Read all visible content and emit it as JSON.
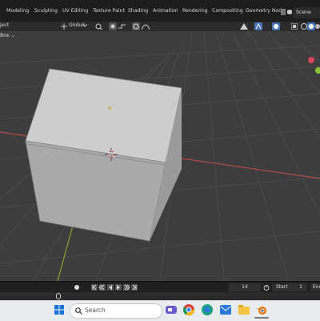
{
  "workspace_tabs": [
    {
      "label": "Modeling",
      "active": false
    },
    {
      "label": "Sculpting",
      "active": false
    },
    {
      "label": "UV Editing",
      "active": false
    },
    {
      "label": "Texture Paint",
      "active": false
    },
    {
      "label": "Shading",
      "active": false
    },
    {
      "label": "Animation",
      "active": false
    },
    {
      "label": "Rendering",
      "active": false
    },
    {
      "label": "Compositing",
      "active": false
    },
    {
      "label": "Geometry Nod",
      "active": false
    }
  ],
  "scene": {
    "label": "Scene"
  },
  "header": {
    "object_menu": "ject",
    "transform_orientation": "Global",
    "select_box": "Box"
  },
  "timeline": {
    "current_frame": "14",
    "start_label": "Start",
    "start_value": "1",
    "end_label": "End"
  },
  "taskbar": {
    "search_placeholder": "Search"
  },
  "colors": {
    "x_axis": "#b54a4a",
    "y_axis": "#8aa22a",
    "grid": "#4a4a4a",
    "viewport_bg": "#3d3d3d",
    "cube_top": "#cdcdcd",
    "cube_front": "#a9a9a9",
    "cube_side": "#9a9a9a"
  }
}
